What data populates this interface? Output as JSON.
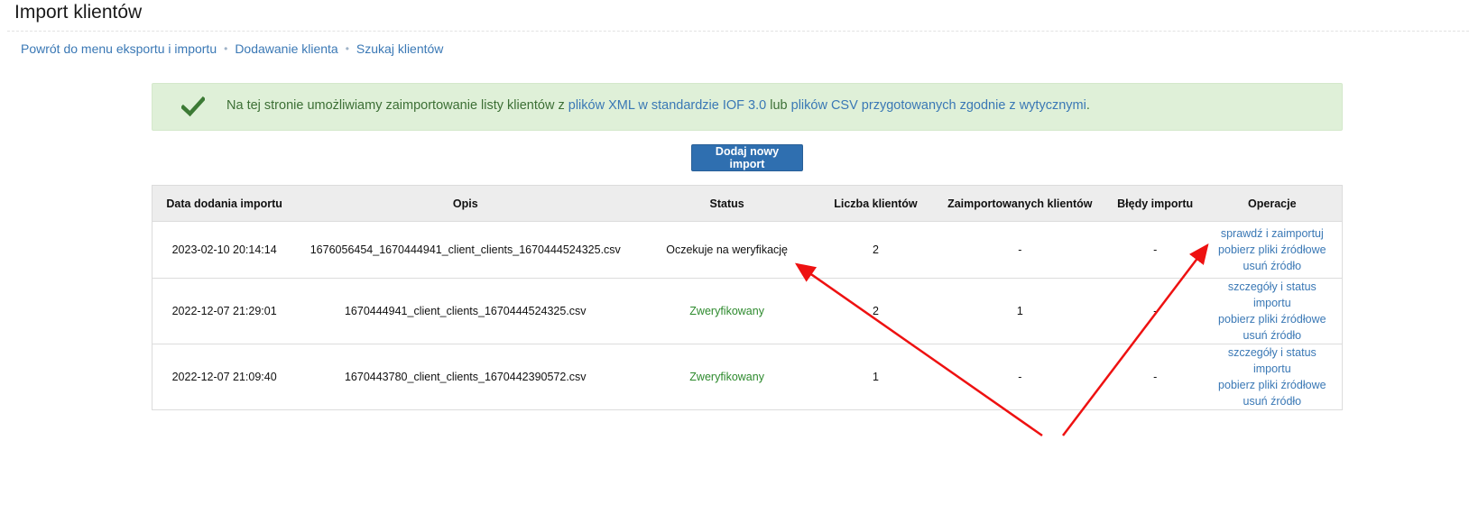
{
  "page": {
    "title": "Import klientów"
  },
  "breadcrumb": [
    {
      "label": "Powrót do menu eksportu i importu"
    },
    {
      "label": "Dodawanie klienta"
    },
    {
      "label": "Szukaj klientów"
    }
  ],
  "alert": {
    "icon": "check-icon",
    "text_before": "Na tej stronie umożliwiamy zaimportowanie listy klientów z ",
    "link1": "plików XML w standardzie IOF 3.0",
    "text_middle": " lub ",
    "link2": "plików CSV przygotowanych zgodnie z wytycznymi",
    "text_after": "."
  },
  "add_button": {
    "label": "Dodaj nowy import"
  },
  "table": {
    "headers": [
      "Data dodania importu",
      "Opis",
      "Status",
      "Liczba klientów",
      "Zaimportowanych klientów",
      "Błędy importu",
      "Operacje"
    ],
    "rows": [
      {
        "date": "2023-02-10 20:14:14",
        "description": "1676056454_1670444941_client_clients_1670444524325.csv",
        "status": "Oczekuje na weryfikację",
        "clients": "2",
        "imported": "-",
        "errors": "-",
        "operations": [
          "sprawdź i zaimportuj",
          "pobierz pliki źródłowe",
          "usuń źródło"
        ]
      },
      {
        "date": "2022-12-07 21:29:01",
        "description": "1670444941_client_clients_1670444524325.csv",
        "status": "Zweryfikowany",
        "clients": "2",
        "imported": "1",
        "errors": "-",
        "operations": [
          "szczegóły i status importu",
          "pobierz pliki źródłowe",
          "usuń źródło"
        ]
      },
      {
        "date": "2022-12-07 21:09:40",
        "description": "1670443780_client_clients_1670442390572.csv",
        "status": "Zweryfikowany",
        "clients": "1",
        "imported": "-",
        "errors": "-",
        "operations": [
          "szczegóły i status importu",
          "pobierz pliki źródłowe",
          "usuń źródło"
        ]
      }
    ]
  },
  "colors": {
    "accent": "#2f6fb0",
    "link": "#3a78b5",
    "success_bg": "#dff0d8",
    "success_text": "#3c6f35",
    "annotation_arrow": "#ee1111"
  }
}
